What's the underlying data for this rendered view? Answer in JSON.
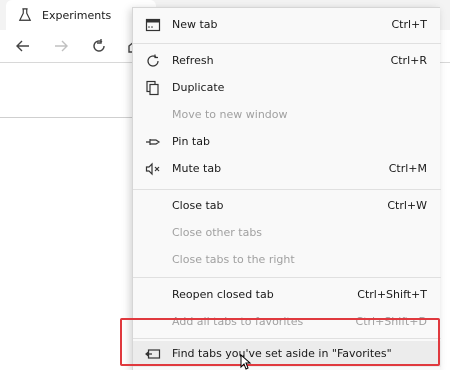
{
  "browser": {
    "tab_title": "Experiments"
  },
  "menu": {
    "items": [
      {
        "label": "New tab",
        "shortcut": "Ctrl+T",
        "icon": "new-tab-icon",
        "enabled": true
      },
      {
        "label": "Refresh",
        "shortcut": "Ctrl+R",
        "icon": "refresh-icon",
        "enabled": true
      },
      {
        "label": "Duplicate",
        "shortcut": "",
        "icon": "duplicate-icon",
        "enabled": true
      },
      {
        "label": "Move to new window",
        "shortcut": "",
        "icon": "",
        "enabled": false
      },
      {
        "label": "Pin tab",
        "shortcut": "",
        "icon": "pin-icon",
        "enabled": true
      },
      {
        "label": "Mute tab",
        "shortcut": "Ctrl+M",
        "icon": "mute-icon",
        "enabled": true
      },
      {
        "label": "Close tab",
        "shortcut": "Ctrl+W",
        "icon": "",
        "enabled": true
      },
      {
        "label": "Close other tabs",
        "shortcut": "",
        "icon": "",
        "enabled": false
      },
      {
        "label": "Close tabs to the right",
        "shortcut": "",
        "icon": "",
        "enabled": false
      },
      {
        "label": "Reopen closed tab",
        "shortcut": "Ctrl+Shift+T",
        "icon": "",
        "enabled": true
      },
      {
        "label": "Add all tabs to favorites",
        "shortcut": "Ctrl+Shift+D",
        "icon": "",
        "enabled": false
      },
      {
        "label": "Find tabs you've set aside in \"Favorites\"",
        "shortcut": "",
        "icon": "set-aside-icon",
        "enabled": true
      }
    ]
  },
  "colors": {
    "highlight_border": "#e0393e",
    "menu_bg": "#f9f9f9",
    "disabled_text": "#a0a0a0"
  }
}
